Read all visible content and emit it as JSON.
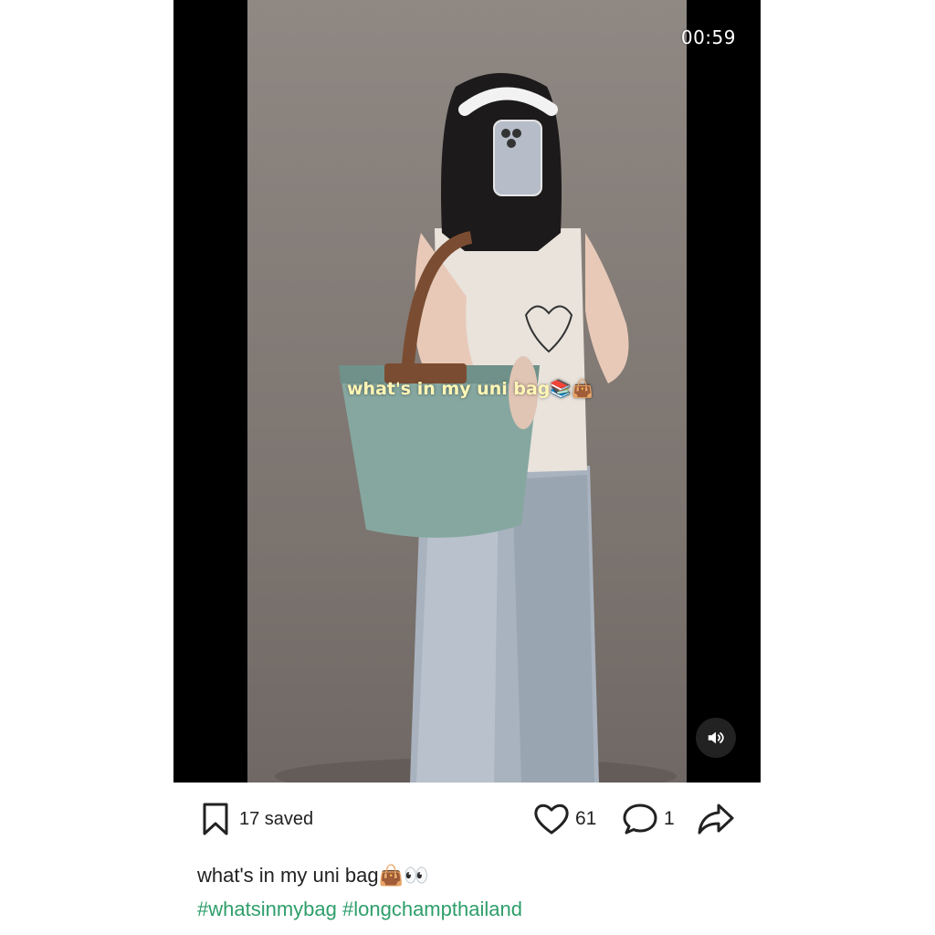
{
  "video": {
    "timer": "00:59",
    "overlay_caption": "what's in my uni bag📚👜",
    "sound_icon": "volume-icon"
  },
  "actions": {
    "saved_label": "17 saved",
    "likes": "61",
    "comments": "1",
    "icons": [
      "bookmark-icon",
      "heart-icon",
      "comment-icon",
      "share-icon"
    ]
  },
  "post": {
    "caption": "what's in my uni bag👜👀",
    "hashtags": [
      "#whatsinmybag",
      "#longchampthailand"
    ]
  },
  "colors": {
    "hashtag": "#2e9e6a",
    "overlay_text": "#fff6b5"
  }
}
